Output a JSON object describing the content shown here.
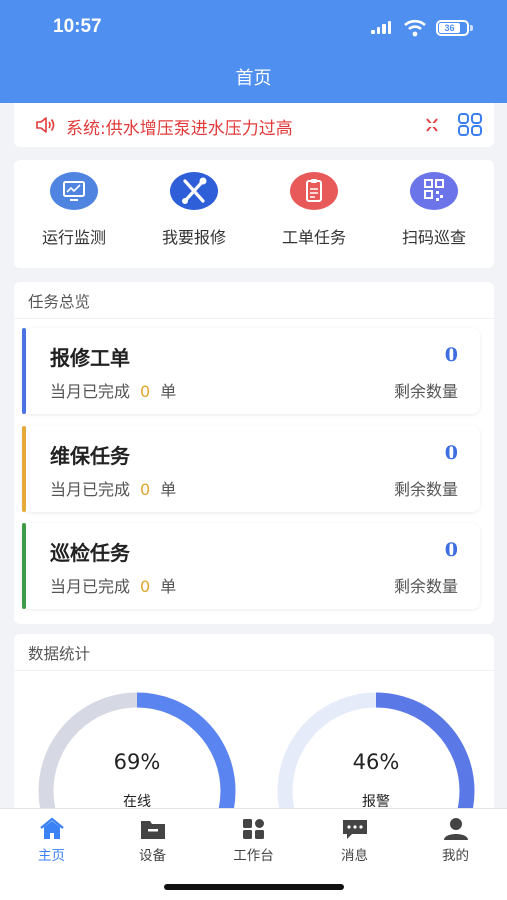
{
  "status_bar": {
    "time": "10:57",
    "battery": "36"
  },
  "header": {
    "title": "首页"
  },
  "notice": {
    "text": "系统:供水增压泵进水压力过高"
  },
  "quick_actions": [
    {
      "label": "运行监测",
      "icon": "monitor-icon",
      "color": "#4f84e0"
    },
    {
      "label": "我要报修",
      "icon": "wrench-icon",
      "color": "#2f5fd8"
    },
    {
      "label": "工单任务",
      "icon": "clipboard-icon",
      "color": "#e85a5a"
    },
    {
      "label": "扫码巡查",
      "icon": "qr-code-icon",
      "color": "#6b74e8"
    }
  ],
  "task_overview": {
    "title": "任务总览",
    "completed_label": "当月已完成",
    "unit": "单",
    "remaining_label": "剩余数量",
    "cards": [
      {
        "name": "报修工单",
        "remaining": "0",
        "completed": "0",
        "color": "#4a72e0"
      },
      {
        "name": "维保任务",
        "remaining": "0",
        "completed": "0",
        "color": "#e6aa3b"
      },
      {
        "name": "巡检任务",
        "remaining": "0",
        "completed": "0",
        "color": "#3e9a48"
      }
    ]
  },
  "data_stats": {
    "title": "数据统计",
    "gauges": [
      {
        "percent": "69%",
        "value": 0.69,
        "label": "在线",
        "color": "#5a84f0",
        "track": "#d6d9e3"
      },
      {
        "percent": "46%",
        "value": 0.46,
        "label": "报警",
        "color": "#5a78e6",
        "track": "#e6ebf9"
      }
    ]
  },
  "tab_bar": [
    {
      "label": "主页",
      "icon": "home-icon",
      "active": true
    },
    {
      "label": "设备",
      "icon": "folder-icon",
      "active": false
    },
    {
      "label": "工作台",
      "icon": "workbench-icon",
      "active": false
    },
    {
      "label": "消息",
      "icon": "message-icon",
      "active": false
    },
    {
      "label": "我的",
      "icon": "user-icon",
      "active": false
    }
  ],
  "colors": {
    "primary": "#4f8ff0",
    "tab_active": "#3b82f6",
    "alert": "#e23b3b"
  }
}
